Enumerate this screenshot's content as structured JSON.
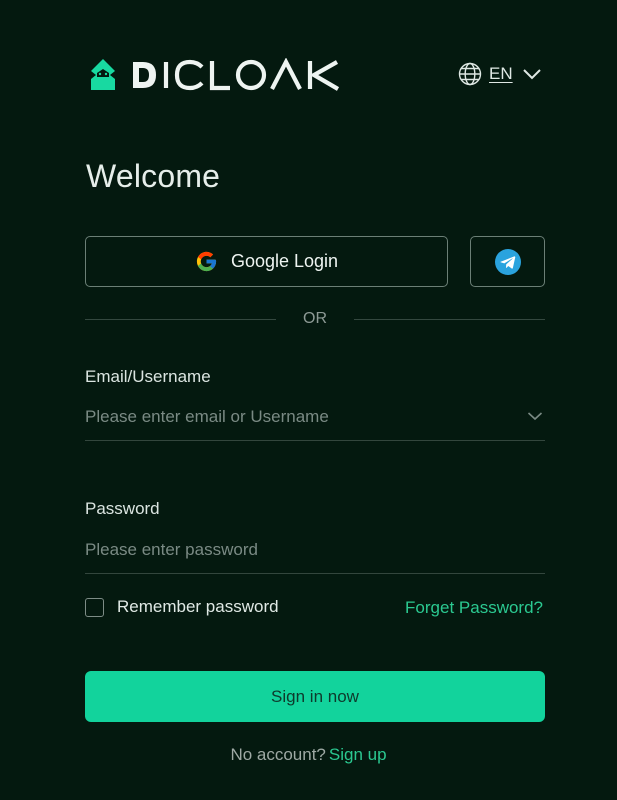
{
  "header": {
    "logo_text": "DICLOAK",
    "language": {
      "code": "EN",
      "icon": "globe-icon",
      "dropdown_icon": "chevron-down-icon"
    }
  },
  "title": "Welcome",
  "social": {
    "google_label": "Google Login",
    "google_icon": "google-icon",
    "telegram_icon": "telegram-icon"
  },
  "divider_text": "OR",
  "email": {
    "label": "Email/Username",
    "placeholder": "Please enter email or Username",
    "value": "",
    "dropdown_icon": "chevron-down-icon"
  },
  "password": {
    "label": "Password",
    "placeholder": "Please enter password",
    "value": ""
  },
  "remember": {
    "label": "Remember password",
    "checked": false
  },
  "forgot_label": "Forget Password?",
  "signin_label": "Sign in now",
  "signup": {
    "question": "No account?",
    "link": "Sign up"
  },
  "colors": {
    "background": "#04190f",
    "accent": "#12d39c",
    "link": "#2bc991",
    "telegram": "#2aa3de"
  }
}
